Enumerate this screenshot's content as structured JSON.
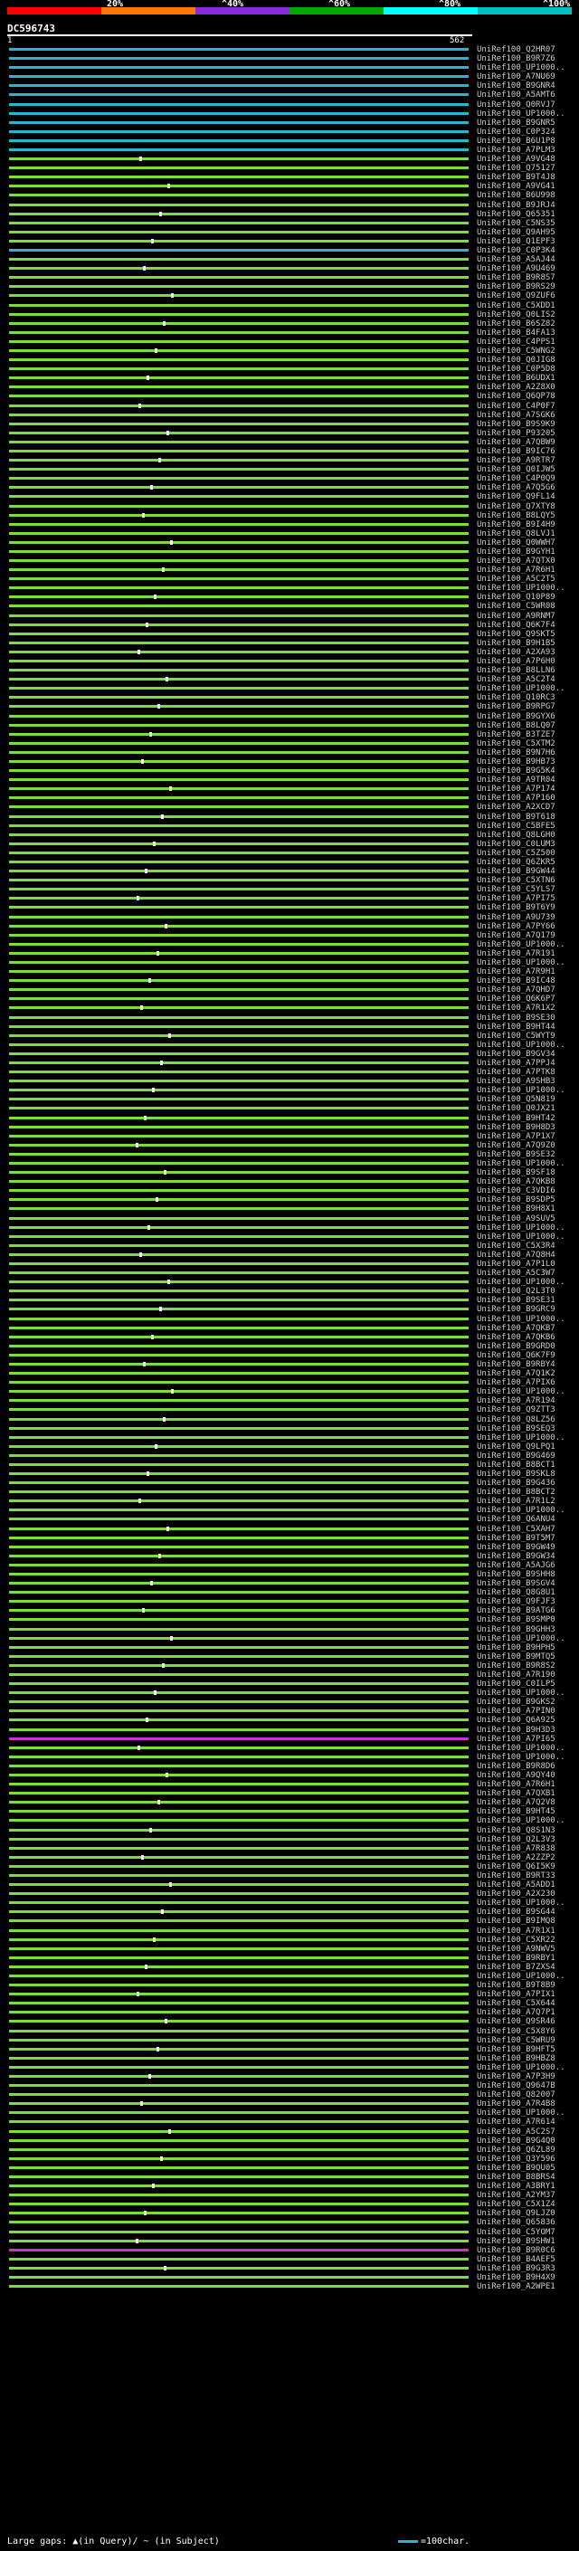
{
  "legend": {
    "percent_labels": [
      "20%",
      "^40%",
      "^60%",
      "^80%",
      "^100%"
    ],
    "colors": [
      "#ff0000",
      "#ff7700",
      "#8a2be2",
      "#00aa00",
      "#00ffff",
      "#00c0c0"
    ]
  },
  "query": {
    "id": "DC596743",
    "start": "1",
    "end": "562"
  },
  "hits": [
    {
      "id": "UniRef100_Q2HR07",
      "color": "#2ab4d0"
    },
    {
      "id": "UniRef100_B9R7Z6",
      "color": "#2ab4d0"
    },
    {
      "id": "UniRef100_UP1000..",
      "color": "#2ab4d0"
    },
    {
      "id": "UniRef100_A7NU69",
      "color": "#2ab4d0"
    },
    {
      "id": "UniRef100_B9GNR4",
      "color": "#2ab4d0"
    },
    {
      "id": "UniRef100_A5AMT6",
      "color": "#2ab4d0"
    },
    {
      "id": "UniRef100_Q0RVJ7",
      "color": "#2ab4d0"
    },
    {
      "id": "UniRef100_UP1000..",
      "color": "#2ab4d0"
    },
    {
      "id": "UniRef100_B9GNR5",
      "color": "#2ab4d0"
    },
    {
      "id": "UniRef100_C0P324",
      "color": "#2ab4d0"
    },
    {
      "id": "UniRef100_B6U1P8",
      "color": "#2ab4d0"
    },
    {
      "id": "UniRef100_A7PLM3",
      "color": "#2ab4d0"
    },
    {
      "id": "UniRef100_A9VG48",
      "color": "#7cdc3c"
    },
    {
      "id": "UniRef100_Q75127",
      "color": "#7cdc3c"
    },
    {
      "id": "UniRef100_B9T4J8",
      "color": "#7cdc3c"
    },
    {
      "id": "UniRef100_A9VG41",
      "color": "#7cdc3c"
    },
    {
      "id": "UniRef100_B6U998",
      "color": "#7cdc3c"
    },
    {
      "id": "UniRef100_B9JRJ4",
      "color": "#7cdc3c"
    },
    {
      "id": "UniRef100_Q65351",
      "color": "#7cdc3c"
    },
    {
      "id": "UniRef100_C5NS35",
      "color": "#7cdc3c"
    },
    {
      "id": "UniRef100_Q9AH95",
      "color": "#7cdc3c"
    },
    {
      "id": "UniRef100_Q1EPF3",
      "color": "#7cdc3c"
    },
    {
      "id": "UniRef100_C0P3K4",
      "color": "#2ab4d0"
    },
    {
      "id": "UniRef100_A5AJ44",
      "color": "#7cdc3c"
    },
    {
      "id": "UniRef100_A9U469",
      "color": "#7cdc3c"
    },
    {
      "id": "UniRef100_B9R8S7",
      "color": "#7cdc3c"
    },
    {
      "id": "UniRef100_B9RS29",
      "color": "#7cdc3c"
    },
    {
      "id": "UniRef100_Q9ZUF6",
      "color": "#7cdc3c"
    },
    {
      "id": "UniRef100_C5XDD1",
      "color": "#7cdc3c"
    },
    {
      "id": "UniRef100_Q0LIS2",
      "color": "#7cdc3c"
    },
    {
      "id": "UniRef100_B6SZ82",
      "color": "#7cdc3c"
    },
    {
      "id": "UniRef100_B4FA13",
      "color": "#7cdc3c"
    },
    {
      "id": "UniRef100_C4PPS1",
      "color": "#7cdc3c"
    },
    {
      "id": "UniRef100_C5WNG2",
      "color": "#7cdc3c"
    },
    {
      "id": "UniRef100_Q0JIG8",
      "color": "#7cdc3c"
    },
    {
      "id": "UniRef100_C0P5D8",
      "color": "#7cdc3c"
    },
    {
      "id": "UniRef100_B6UDX1",
      "color": "#7cdc3c"
    },
    {
      "id": "UniRef100_A2Z8X0",
      "color": "#7cdc3c"
    },
    {
      "id": "UniRef100_Q6QP78",
      "color": "#7cdc3c"
    },
    {
      "id": "UniRef100_C4P0F7",
      "color": "#7cdc3c"
    },
    {
      "id": "UniRef100_A7SGK6",
      "color": "#7cdc3c"
    },
    {
      "id": "UniRef100_B9S9K9",
      "color": "#7cdc3c"
    },
    {
      "id": "UniRef100_P93205",
      "color": "#7cdc3c"
    },
    {
      "id": "UniRef100_A7QBW9",
      "color": "#7cdc3c"
    },
    {
      "id": "UniRef100_B9IC76",
      "color": "#7cdc3c"
    },
    {
      "id": "UniRef100_A9RTR7",
      "color": "#7cdc3c"
    },
    {
      "id": "UniRef100_Q0IJW5",
      "color": "#7cdc3c"
    },
    {
      "id": "UniRef100_C4P0Q9",
      "color": "#7cdc3c"
    },
    {
      "id": "UniRef100_A7Q5G6",
      "color": "#7cdc3c"
    },
    {
      "id": "UniRef100_Q9FL14",
      "color": "#7cdc3c"
    },
    {
      "id": "UniRef100_Q7XTY8",
      "color": "#7cdc3c"
    },
    {
      "id": "UniRef100_B8LQY5",
      "color": "#7cdc3c"
    },
    {
      "id": "UniRef100_B9I4H9",
      "color": "#7cdc3c"
    },
    {
      "id": "UniRef100_Q8LVJ1",
      "color": "#7cdc3c"
    },
    {
      "id": "UniRef100_Q0WWH7",
      "color": "#7cdc3c"
    },
    {
      "id": "UniRef100_B9GYH1",
      "color": "#7cdc3c"
    },
    {
      "id": "UniRef100_A7QTX0",
      "color": "#7cdc3c"
    },
    {
      "id": "UniRef100_A7R6H1",
      "color": "#7cdc3c"
    },
    {
      "id": "UniRef100_A5C2T5",
      "color": "#7cdc3c"
    },
    {
      "id": "UniRef100_UP1000..",
      "color": "#7cdc3c"
    },
    {
      "id": "UniRef100_Q10P89",
      "color": "#7cdc3c"
    },
    {
      "id": "UniRef100_C5WR08",
      "color": "#7cdc3c"
    },
    {
      "id": "UniRef100_A9RNM7",
      "color": "#7cdc3c"
    },
    {
      "id": "UniRef100_Q6K7F4",
      "color": "#7cdc3c"
    },
    {
      "id": "UniRef100_Q9SKT5",
      "color": "#7cdc3c"
    },
    {
      "id": "UniRef100_B9H1B5",
      "color": "#7cdc3c"
    },
    {
      "id": "UniRef100_A2XA93",
      "color": "#7cdc3c"
    },
    {
      "id": "UniRef100_A7P6H0",
      "color": "#7cdc3c"
    },
    {
      "id": "UniRef100_B8LLN6",
      "color": "#7cdc3c"
    },
    {
      "id": "UniRef100_A5C2T4",
      "color": "#7cdc3c"
    },
    {
      "id": "UniRef100_UP1000..",
      "color": "#7cdc3c"
    },
    {
      "id": "UniRef100_Q10RC3",
      "color": "#7cdc3c"
    },
    {
      "id": "UniRef100_B9RPG7",
      "color": "#7cdc3c"
    },
    {
      "id": "UniRef100_B9GYX6",
      "color": "#7cdc3c"
    },
    {
      "id": "UniRef100_B8LQ07",
      "color": "#7cdc3c"
    },
    {
      "id": "UniRef100_B3TZE7",
      "color": "#7cdc3c"
    },
    {
      "id": "UniRef100_C5XTM2",
      "color": "#7cdc3c"
    },
    {
      "id": "UniRef100_B9N7H6",
      "color": "#7cdc3c"
    },
    {
      "id": "UniRef100_B9HB73",
      "color": "#7cdc3c"
    },
    {
      "id": "UniRef100_B9G5K4",
      "color": "#7cdc3c"
    },
    {
      "id": "UniRef100_A9TR04",
      "color": "#7cdc3c"
    },
    {
      "id": "UniRef100_A7P174",
      "color": "#7cdc3c"
    },
    {
      "id": "UniRef100_A7P160",
      "color": "#7cdc3c"
    },
    {
      "id": "UniRef100_A2XCD7",
      "color": "#7cdc3c"
    },
    {
      "id": "UniRef100_B9T618",
      "color": "#7cdc3c"
    },
    {
      "id": "UniRef100_C5BFE5",
      "color": "#7cdc3c"
    },
    {
      "id": "UniRef100_Q8LGH0",
      "color": "#7cdc3c"
    },
    {
      "id": "UniRef100_C0LUM3",
      "color": "#7cdc3c"
    },
    {
      "id": "UniRef100_C5Z500",
      "color": "#7cdc3c"
    },
    {
      "id": "UniRef100_Q6ZKR5",
      "color": "#7cdc3c"
    },
    {
      "id": "UniRef100_B9GW44",
      "color": "#7cdc3c"
    },
    {
      "id": "UniRef100_C5XTN6",
      "color": "#7cdc3c"
    },
    {
      "id": "UniRef100_C5YLS7",
      "color": "#7cdc3c"
    },
    {
      "id": "UniRef100_A7PI75",
      "color": "#7cdc3c"
    },
    {
      "id": "UniRef100_B9T6Y9",
      "color": "#7cdc3c"
    },
    {
      "id": "UniRef100_A9U739",
      "color": "#7cdc3c"
    },
    {
      "id": "UniRef100_A7PY66",
      "color": "#7cdc3c"
    },
    {
      "id": "UniRef100_A7Q179",
      "color": "#7cdc3c"
    },
    {
      "id": "UniRef100_UP1000..",
      "color": "#7cdc3c"
    },
    {
      "id": "UniRef100_A7R191",
      "color": "#7cdc3c"
    },
    {
      "id": "UniRef100_UP1000..",
      "color": "#7cdc3c"
    },
    {
      "id": "UniRef100_A7R9H1",
      "color": "#7cdc3c"
    },
    {
      "id": "UniRef100_B9IC48",
      "color": "#7cdc3c"
    },
    {
      "id": "UniRef100_A7QHD7",
      "color": "#7cdc3c"
    },
    {
      "id": "UniRef100_Q6K6P7",
      "color": "#7cdc3c"
    },
    {
      "id": "UniRef100_A7R1X2",
      "color": "#7cdc3c"
    },
    {
      "id": "UniRef100_B9SE30",
      "color": "#7cdc3c"
    },
    {
      "id": "UniRef100_B9HT44",
      "color": "#7cdc3c"
    },
    {
      "id": "UniRef100_C5WYT9",
      "color": "#7cdc3c"
    },
    {
      "id": "UniRef100_UP1000..",
      "color": "#7cdc3c"
    },
    {
      "id": "UniRef100_B9GV34",
      "color": "#7cdc3c"
    },
    {
      "id": "UniRef100_A7PPJ4",
      "color": "#7cdc3c"
    },
    {
      "id": "UniRef100_A7PTK8",
      "color": "#7cdc3c"
    },
    {
      "id": "UniRef100_A9SHB3",
      "color": "#7cdc3c"
    },
    {
      "id": "UniRef100_UP1000..",
      "color": "#7cdc3c"
    },
    {
      "id": "UniRef100_Q5N819",
      "color": "#7cdc3c"
    },
    {
      "id": "UniRef100_Q0JX21",
      "color": "#7cdc3c"
    },
    {
      "id": "UniRef100_B9HT42",
      "color": "#7cdc3c"
    },
    {
      "id": "UniRef100_B9H8D3",
      "color": "#7cdc3c"
    },
    {
      "id": "UniRef100_A7P1X7",
      "color": "#7cdc3c"
    },
    {
      "id": "UniRef100_A7Q9Z0",
      "color": "#7cdc3c"
    },
    {
      "id": "UniRef100_B9SE32",
      "color": "#7cdc3c"
    },
    {
      "id": "UniRef100_UP1000..",
      "color": "#7cdc3c"
    },
    {
      "id": "UniRef100_B9SF18",
      "color": "#7cdc3c"
    },
    {
      "id": "UniRef100_A7QKB8",
      "color": "#7cdc3c"
    },
    {
      "id": "UniRef100_C3VDI6",
      "color": "#7cdc3c"
    },
    {
      "id": "UniRef100_B9SDP5",
      "color": "#7cdc3c"
    },
    {
      "id": "UniRef100_B9H8X1",
      "color": "#7cdc3c"
    },
    {
      "id": "UniRef100_A9SUV5",
      "color": "#7cdc3c"
    },
    {
      "id": "UniRef100_UP1000..",
      "color": "#7cdc3c"
    },
    {
      "id": "UniRef100_UP1000..",
      "color": "#7cdc3c"
    },
    {
      "id": "UniRef100_C5X3R4",
      "color": "#7cdc3c"
    },
    {
      "id": "UniRef100_A7Q8H4",
      "color": "#7cdc3c"
    },
    {
      "id": "UniRef100_A7P1L0",
      "color": "#7cdc3c"
    },
    {
      "id": "UniRef100_A5C3W7",
      "color": "#7cdc3c"
    },
    {
      "id": "UniRef100_UP1000..",
      "color": "#7cdc3c"
    },
    {
      "id": "UniRef100_Q2L3T0",
      "color": "#7cdc3c"
    },
    {
      "id": "UniRef100_B9SE31",
      "color": "#7cdc3c"
    },
    {
      "id": "UniRef100_B9GRC9",
      "color": "#7cdc3c"
    },
    {
      "id": "UniRef100_UP1000..",
      "color": "#7cdc3c"
    },
    {
      "id": "UniRef100_A7QKB7",
      "color": "#7cdc3c"
    },
    {
      "id": "UniRef100_A7QKB6",
      "color": "#7cdc3c"
    },
    {
      "id": "UniRef100_B9GRD0",
      "color": "#7cdc3c"
    },
    {
      "id": "UniRef100_Q6K7F9",
      "color": "#7cdc3c"
    },
    {
      "id": "UniRef100_B9RBY4",
      "color": "#7cdc3c"
    },
    {
      "id": "UniRef100_A7Q1K2",
      "color": "#7cdc3c"
    },
    {
      "id": "UniRef100_A7PIX6",
      "color": "#7cdc3c"
    },
    {
      "id": "UniRef100_UP1000..",
      "color": "#7cdc3c"
    },
    {
      "id": "UniRef100_A7R194",
      "color": "#7cdc3c"
    },
    {
      "id": "UniRef100_Q9ZTT3",
      "color": "#7cdc3c"
    },
    {
      "id": "UniRef100_Q8LZ56",
      "color": "#7cdc3c"
    },
    {
      "id": "UniRef100_B9SEQ3",
      "color": "#7cdc3c"
    },
    {
      "id": "UniRef100_UP1000..",
      "color": "#7cdc3c"
    },
    {
      "id": "UniRef100_Q9LPQ1",
      "color": "#7cdc3c"
    },
    {
      "id": "UniRef100_B9G469",
      "color": "#7cdc3c"
    },
    {
      "id": "UniRef100_B8BCT1",
      "color": "#7cdc3c"
    },
    {
      "id": "UniRef100_B9SKL8",
      "color": "#7cdc3c"
    },
    {
      "id": "UniRef100_B9G436",
      "color": "#7cdc3c"
    },
    {
      "id": "UniRef100_B8BCT2",
      "color": "#7cdc3c"
    },
    {
      "id": "UniRef100_A7R1L2",
      "color": "#7cdc3c"
    },
    {
      "id": "UniRef100_UP1000..",
      "color": "#7cdc3c"
    },
    {
      "id": "UniRef100_Q6ANU4",
      "color": "#7cdc3c"
    },
    {
      "id": "UniRef100_C5XAH7",
      "color": "#7cdc3c"
    },
    {
      "id": "UniRef100_B9T5M7",
      "color": "#7cdc3c"
    },
    {
      "id": "UniRef100_B9GW49",
      "color": "#7cdc3c"
    },
    {
      "id": "UniRef100_B9GW34",
      "color": "#7cdc3c"
    },
    {
      "id": "UniRef100_A5AJG6",
      "color": "#7cdc3c"
    },
    {
      "id": "UniRef100_B9SHH8",
      "color": "#7cdc3c"
    },
    {
      "id": "UniRef100_B9SGV4",
      "color": "#7cdc3c"
    },
    {
      "id": "UniRef100_Q8G8U1",
      "color": "#7cdc3c"
    },
    {
      "id": "UniRef100_Q9FJF3",
      "color": "#7cdc3c"
    },
    {
      "id": "UniRef100_B9ATG6",
      "color": "#7cdc3c"
    },
    {
      "id": "UniRef100_B9SMP0",
      "color": "#7cdc3c"
    },
    {
      "id": "UniRef100_B9GHH3",
      "color": "#7cdc3c"
    },
    {
      "id": "UniRef100_UP1000..",
      "color": "#7cdc3c"
    },
    {
      "id": "UniRef100_B9HPH5",
      "color": "#7cdc3c"
    },
    {
      "id": "UniRef100_B9MTQ5",
      "color": "#7cdc3c"
    },
    {
      "id": "UniRef100_B9R8S2",
      "color": "#7cdc3c"
    },
    {
      "id": "UniRef100_A7R190",
      "color": "#7cdc3c"
    },
    {
      "id": "UniRef100_C0ILP5",
      "color": "#7cdc3c"
    },
    {
      "id": "UniRef100_UP1000..",
      "color": "#7cdc3c"
    },
    {
      "id": "UniRef100_B9GKS2",
      "color": "#7cdc3c"
    },
    {
      "id": "UniRef100_A7PIN0",
      "color": "#7cdc3c"
    },
    {
      "id": "UniRef100_Q6A925",
      "color": "#7cdc3c"
    },
    {
      "id": "UniRef100_B9H3D3",
      "color": "#7cdc3c"
    },
    {
      "id": "UniRef100_A7PI65",
      "color": "#cc33cc"
    },
    {
      "id": "UniRef100_UP1000..",
      "color": "#7cdc3c"
    },
    {
      "id": "UniRef100_UP1000..",
      "color": "#7cdc3c"
    },
    {
      "id": "UniRef100_B9R8D6",
      "color": "#7cdc3c"
    },
    {
      "id": "UniRef100_A9QY40",
      "color": "#7cdc3c"
    },
    {
      "id": "UniRef100_A7R6H1",
      "color": "#7cdc3c"
    },
    {
      "id": "UniRef100_A7QXB1",
      "color": "#7cdc3c"
    },
    {
      "id": "UniRef100_A7Q2V8",
      "color": "#7cdc3c"
    },
    {
      "id": "UniRef100_B9HT45",
      "color": "#7cdc3c"
    },
    {
      "id": "UniRef100_UP1000..",
      "color": "#7cdc3c"
    },
    {
      "id": "UniRef100_Q8S1N3",
      "color": "#7cdc3c"
    },
    {
      "id": "UniRef100_Q2L3V3",
      "color": "#7cdc3c"
    },
    {
      "id": "UniRef100_A7R838",
      "color": "#7cdc3c"
    },
    {
      "id": "UniRef100_A2ZZP2",
      "color": "#7cdc3c"
    },
    {
      "id": "UniRef100_Q6I5K9",
      "color": "#7cdc3c"
    },
    {
      "id": "UniRef100_B9RT33",
      "color": "#7cdc3c"
    },
    {
      "id": "UniRef100_A5ADD1",
      "color": "#7cdc3c"
    },
    {
      "id": "UniRef100_A2X230",
      "color": "#7cdc3c"
    },
    {
      "id": "UniRef100_UP1000..",
      "color": "#7cdc3c"
    },
    {
      "id": "UniRef100_B9SG44",
      "color": "#7cdc3c"
    },
    {
      "id": "UniRef100_B9IMQ8",
      "color": "#7cdc3c"
    },
    {
      "id": "UniRef100_A7R1X1",
      "color": "#7cdc3c"
    },
    {
      "id": "UniRef100_C5XR22",
      "color": "#7cdc3c"
    },
    {
      "id": "UniRef100_A9NWV5",
      "color": "#7cdc3c"
    },
    {
      "id": "UniRef100_B9RBY1",
      "color": "#7cdc3c"
    },
    {
      "id": "UniRef100_B7ZXS4",
      "color": "#7cdc3c"
    },
    {
      "id": "UniRef100_UP1000..",
      "color": "#7cdc3c"
    },
    {
      "id": "UniRef100_B9T8B9",
      "color": "#7cdc3c"
    },
    {
      "id": "UniRef100_A7PIX1",
      "color": "#7cdc3c"
    },
    {
      "id": "UniRef100_C5X644",
      "color": "#7cdc3c"
    },
    {
      "id": "UniRef100_A7Q7P1",
      "color": "#7cdc3c"
    },
    {
      "id": "UniRef100_Q9SR46",
      "color": "#7cdc3c"
    },
    {
      "id": "UniRef100_C5X8Y6",
      "color": "#7cdc3c"
    },
    {
      "id": "UniRef100_C5WRU9",
      "color": "#7cdc3c"
    },
    {
      "id": "UniRef100_B9HFT5",
      "color": "#7cdc3c"
    },
    {
      "id": "UniRef100_B9HBZ8",
      "color": "#7cdc3c"
    },
    {
      "id": "UniRef100_UP1000..",
      "color": "#7cdc3c"
    },
    {
      "id": "UniRef100_A7P3H9",
      "color": "#7cdc3c"
    },
    {
      "id": "UniRef100_Q9647B",
      "color": "#7cdc3c"
    },
    {
      "id": "UniRef100_Q82007",
      "color": "#7cdc3c"
    },
    {
      "id": "UniRef100_A7R4B8",
      "color": "#7cdc3c"
    },
    {
      "id": "UniRef100_UP1000..",
      "color": "#7cdc3c"
    },
    {
      "id": "UniRef100_A7R614",
      "color": "#7cdc3c"
    },
    {
      "id": "UniRef100_A5C2S7",
      "color": "#7cdc3c"
    },
    {
      "id": "UniRef100_B9G4Q0",
      "color": "#7cdc3c"
    },
    {
      "id": "UniRef100_Q6ZL89",
      "color": "#7cdc3c"
    },
    {
      "id": "UniRef100_Q3Y596",
      "color": "#7cdc3c"
    },
    {
      "id": "UniRef100_B9QU05",
      "color": "#7cdc3c"
    },
    {
      "id": "UniRef100_B8BRS4",
      "color": "#7cdc3c"
    },
    {
      "id": "UniRef100_A3BRY1",
      "color": "#7cdc3c"
    },
    {
      "id": "UniRef100_A2YM37",
      "color": "#7cdc3c"
    },
    {
      "id": "UniRef100_C5X1Z4",
      "color": "#7cdc3c"
    },
    {
      "id": "UniRef100_Q9LJZ0",
      "color": "#7cdc3c"
    },
    {
      "id": "UniRef100_Q65836",
      "color": "#7cdc3c"
    },
    {
      "id": "UniRef100_C5YOM7",
      "color": "#7cdc3c"
    },
    {
      "id": "UniRef100_B9SHW1",
      "color": "#7cdc3c"
    },
    {
      "id": "UniRef100_B9R0C6",
      "color": "#cc33cc"
    },
    {
      "id": "UniRef100_B4AEF5",
      "color": "#7cdc3c"
    },
    {
      "id": "UniRef100_B9G3R3",
      "color": "#7cdc3c"
    },
    {
      "id": "UniRef100_B9H4X9",
      "color": "#7cdc3c"
    },
    {
      "id": "UniRef100_A2WPE1",
      "color": "#7cdc3c"
    }
  ],
  "footer": {
    "gaps_text": "Large gaps: ▲(in Query)/ ~ (in Subject)",
    "scale_text": "=100char."
  }
}
